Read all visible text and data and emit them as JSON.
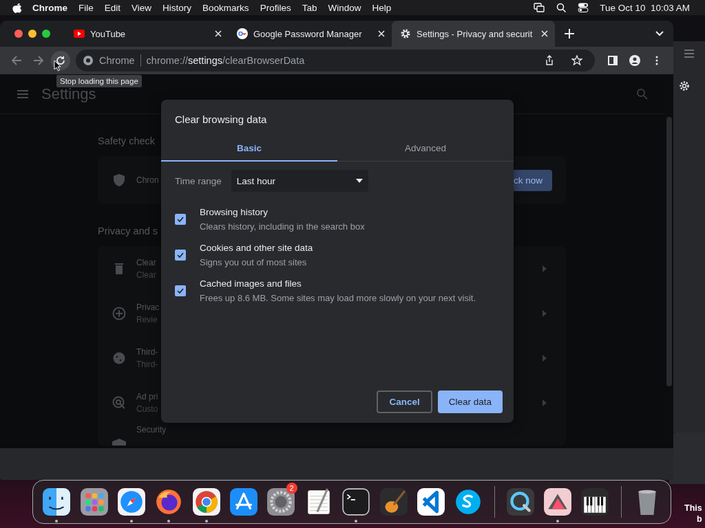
{
  "menu_bar": {
    "app": "Chrome",
    "items": [
      "File",
      "Edit",
      "View",
      "History",
      "Bookmarks",
      "Profiles",
      "Tab",
      "Window",
      "Help"
    ],
    "clock": "Tue Oct 10  10:03 AM"
  },
  "tabs": [
    {
      "title": "YouTube",
      "kind": "youtube",
      "selected": false
    },
    {
      "title": "Google Password Manager",
      "kind": "key",
      "selected": false
    },
    {
      "title": "Settings - Privacy and securit",
      "kind": "gear",
      "selected": true
    }
  ],
  "address_bar": {
    "site_label": "Chrome",
    "url": "chrome://**settings**/clearBrowserData"
  },
  "tooltip": "Stop loading this page",
  "settings": {
    "title": "Settings",
    "sections": [
      {
        "heading": "Safety check",
        "rows": [
          {
            "kind": "shield",
            "title": "Chron",
            "button": "ck now",
            "arrow": false
          }
        ]
      },
      {
        "heading": "Privacy and s",
        "rows": [
          {
            "kind": "trash",
            "title": "Clear",
            "subtitle": "Clear",
            "arrow": true
          },
          {
            "kind": "compass",
            "title": "Privac",
            "subtitle": "Revie",
            "arrow": true
          },
          {
            "kind": "cookie",
            "title": "Third-",
            "subtitle": "Third-",
            "arrow": true
          },
          {
            "kind": "target",
            "title": "Ad pri",
            "subtitle": "Custo",
            "arrow": true
          },
          {
            "kind": "lock",
            "title": "Security",
            "arrow": false
          }
        ]
      }
    ]
  },
  "dialog": {
    "title": "Clear browsing data",
    "tabs": [
      {
        "label": "Basic",
        "selected": true
      },
      {
        "label": "Advanced",
        "selected": false
      }
    ],
    "time_range": {
      "label": "Time range",
      "value": "Last hour"
    },
    "options": [
      {
        "title": "Browsing history",
        "description": "Clears history, including in the search box",
        "checked": true
      },
      {
        "title": "Cookies and other site data",
        "description": "Signs you out of most sites",
        "checked": true
      },
      {
        "title": "Cached images and files",
        "description": "Frees up 8.6 MB. Some sites may load more slowly on your next visit.",
        "checked": true
      }
    ],
    "buttons": [
      {
        "label": "Cancel",
        "kind": "secondary"
      },
      {
        "label": "Clear data",
        "kind": "primary"
      }
    ]
  },
  "dock": {
    "apps": [
      {
        "kind": "finder",
        "running": true
      },
      {
        "kind": "launchpad",
        "running": false
      },
      {
        "kind": "safari",
        "running": true
      },
      {
        "kind": "firefox",
        "running": true
      },
      {
        "kind": "chrome",
        "running": true
      },
      {
        "kind": "appstore",
        "running": false
      },
      {
        "kind": "settings",
        "running": false,
        "badge": "2"
      },
      {
        "kind": "textedit",
        "running": false
      },
      {
        "kind": "terminal",
        "running": true
      },
      {
        "kind": "guitar",
        "running": false
      },
      {
        "kind": "vscode",
        "running": false
      },
      {
        "kind": "skype",
        "running": false
      },
      {
        "kind": "divider"
      },
      {
        "kind": "quicktime",
        "running": false
      },
      {
        "kind": "triangle",
        "running": true
      },
      {
        "kind": "piano",
        "running": false
      },
      {
        "kind": "divider"
      },
      {
        "kind": "trash",
        "running": false
      }
    ]
  },
  "notification": [
    "This",
    "b"
  ]
}
